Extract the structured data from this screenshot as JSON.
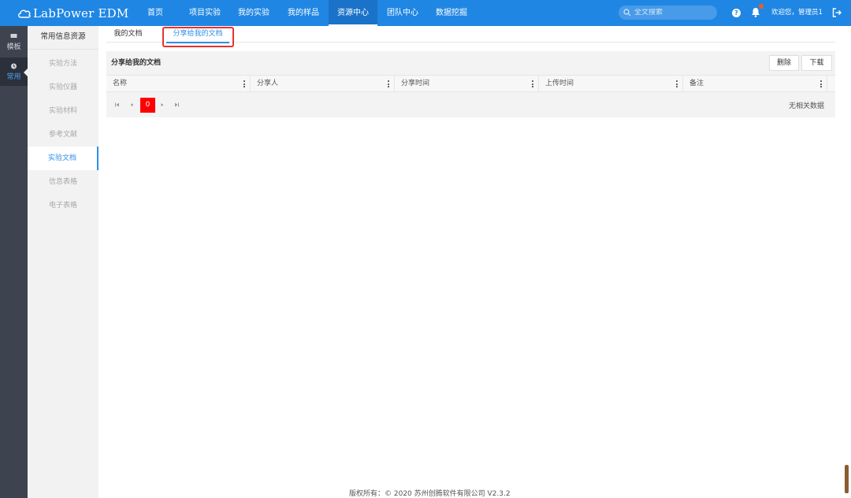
{
  "app": {
    "logo_text": "LabPower EDM"
  },
  "nav": {
    "items": [
      {
        "label": "首页"
      },
      {
        "label": "项目实验"
      },
      {
        "label": "我的实验"
      },
      {
        "label": "我的样品"
      },
      {
        "label": "资源中心"
      },
      {
        "label": "团队中心"
      },
      {
        "label": "数据挖掘"
      }
    ],
    "active": "资源中心"
  },
  "search": {
    "placeholder": "全文搜索"
  },
  "user": {
    "welcome": "欢迎您，管理员1"
  },
  "rail": {
    "items": [
      {
        "label": "模板"
      },
      {
        "label": "常用"
      }
    ]
  },
  "subnav": {
    "title": "常用信息资源",
    "items": [
      {
        "label": "实验方法"
      },
      {
        "label": "实验仪器"
      },
      {
        "label": "实验材料"
      },
      {
        "label": "参考文献"
      },
      {
        "label": "实验文档"
      },
      {
        "label": "信息表格"
      },
      {
        "label": "电子表格"
      }
    ],
    "active": "实验文档"
  },
  "tabs": {
    "items": [
      {
        "label": "我的文档"
      },
      {
        "label": "分享给我的文档"
      }
    ],
    "active": "分享给我的文档"
  },
  "panel": {
    "title": "分享给我的文档",
    "delete_label": "删除",
    "download_label": "下载"
  },
  "table": {
    "columns": [
      "名称",
      "分享人",
      "分享时间",
      "上传时间",
      "备注"
    ],
    "rows": []
  },
  "pager": {
    "current_page": "0",
    "empty_text": "无相关数据"
  },
  "footer": {
    "text": "版权所有：© 2020 苏州创腾软件有限公司   V2.3.2"
  },
  "colors": {
    "topbar": "#1f86e3",
    "accent": "#2b8fe8",
    "highlight": "#e8322e",
    "pager_current": "#ff0000"
  }
}
